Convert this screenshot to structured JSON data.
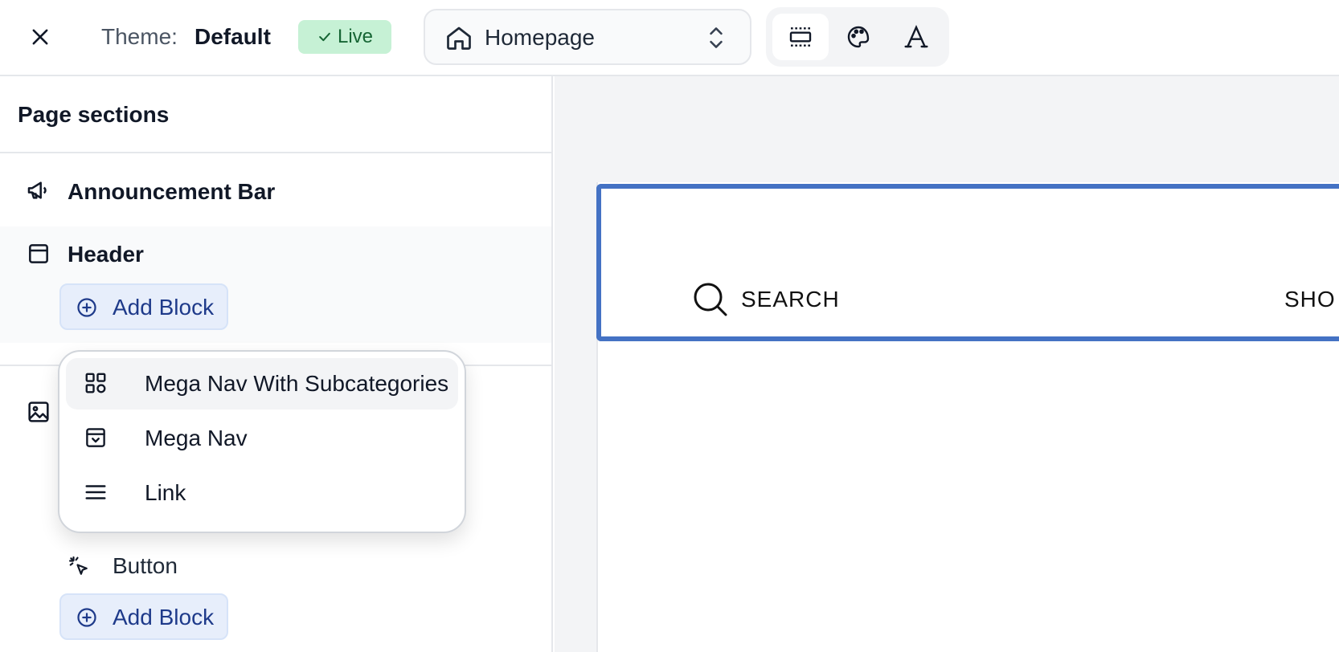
{
  "topbar": {
    "theme_label": "Theme:",
    "theme_name": "Default",
    "status_badge": "Live",
    "page_selector": {
      "selected": "Homepage",
      "icon": "home-icon"
    },
    "view_buttons": [
      {
        "icon": "layout-sections-icon",
        "active": true
      },
      {
        "icon": "palette-icon",
        "active": false
      },
      {
        "icon": "typography-icon",
        "active": false
      }
    ]
  },
  "sidebar": {
    "title": "Page sections",
    "sections": [
      {
        "name": "Announcement Bar",
        "icon": "megaphone-icon"
      },
      {
        "name": "Header",
        "icon": "window-icon"
      }
    ],
    "header_add_block": "Add Block",
    "image_section_icon": "image-icon",
    "blocks": [
      {
        "name": "Button",
        "icon": "click-cursor-icon"
      }
    ],
    "bottom_add_block": "Add Block"
  },
  "add_block_menu": {
    "items": [
      {
        "label": "Mega Nav With Subcategories",
        "icon": "grid-icon",
        "highlighted": true
      },
      {
        "label": "Mega Nav",
        "icon": "archive-box-icon",
        "highlighted": false
      },
      {
        "label": "Link",
        "icon": "menu-lines-icon",
        "highlighted": false
      }
    ]
  },
  "preview": {
    "search_label": "SEARCH",
    "shop_label": "SHO"
  },
  "colors": {
    "selection_outline": "#4472c4",
    "live_badge_bg": "#c6f1d5",
    "add_block_bg": "#e7eefb"
  }
}
